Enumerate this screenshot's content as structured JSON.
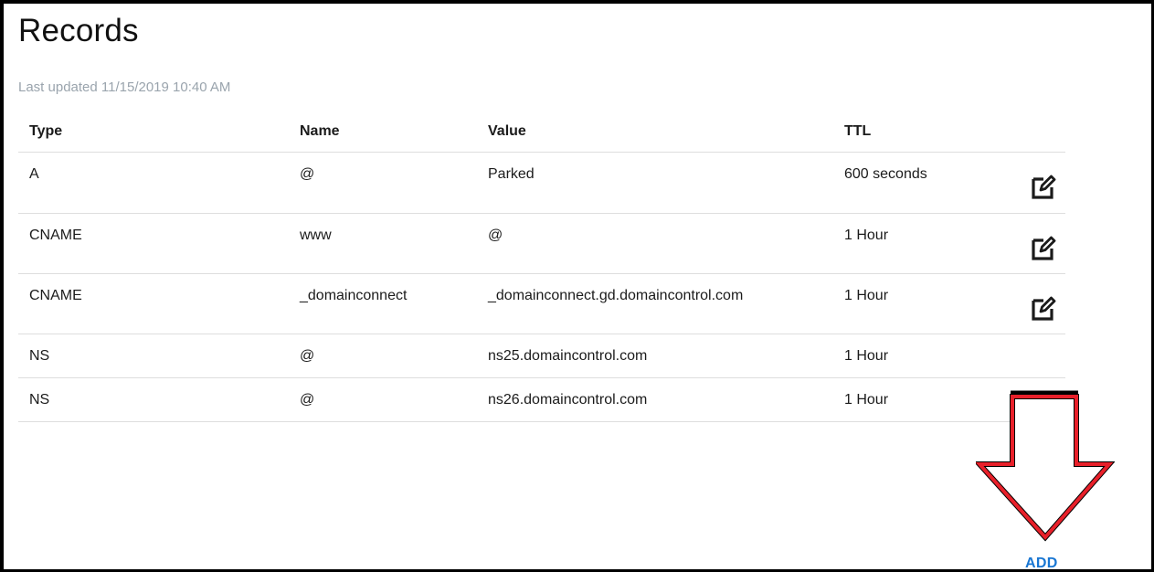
{
  "page": {
    "title": "Records",
    "last_updated": "Last updated 11/15/2019 10:40 AM"
  },
  "table": {
    "headers": {
      "type": "Type",
      "name": "Name",
      "value": "Value",
      "ttl": "TTL"
    },
    "rows": [
      {
        "type": "A",
        "name": "@",
        "value": "Parked",
        "ttl": "600 seconds",
        "editable": true,
        "edit_icon": "edit-icon"
      },
      {
        "type": "CNAME",
        "name": "www",
        "value": "@",
        "ttl": "1 Hour",
        "editable": true,
        "edit_icon": "edit-icon"
      },
      {
        "type": "CNAME",
        "name": "_domainconnect",
        "value": "_domainconnect.gd.domaincontrol.com",
        "ttl": "1 Hour",
        "editable": true,
        "edit_icon": "edit-icon"
      },
      {
        "type": "NS",
        "name": "@",
        "value": "ns25.domaincontrol.com",
        "ttl": "1 Hour",
        "editable": false
      },
      {
        "type": "NS",
        "name": "@",
        "value": "ns26.domaincontrol.com",
        "ttl": "1 Hour",
        "editable": false
      }
    ]
  },
  "actions": {
    "add_label": "ADD"
  },
  "annotation": {
    "arrow_icon": "down-arrow-icon",
    "arrow_color": "#e8202a"
  },
  "colors": {
    "accent": "#1976d2",
    "muted_text": "#9aa4ad",
    "divider": "#dedede"
  }
}
